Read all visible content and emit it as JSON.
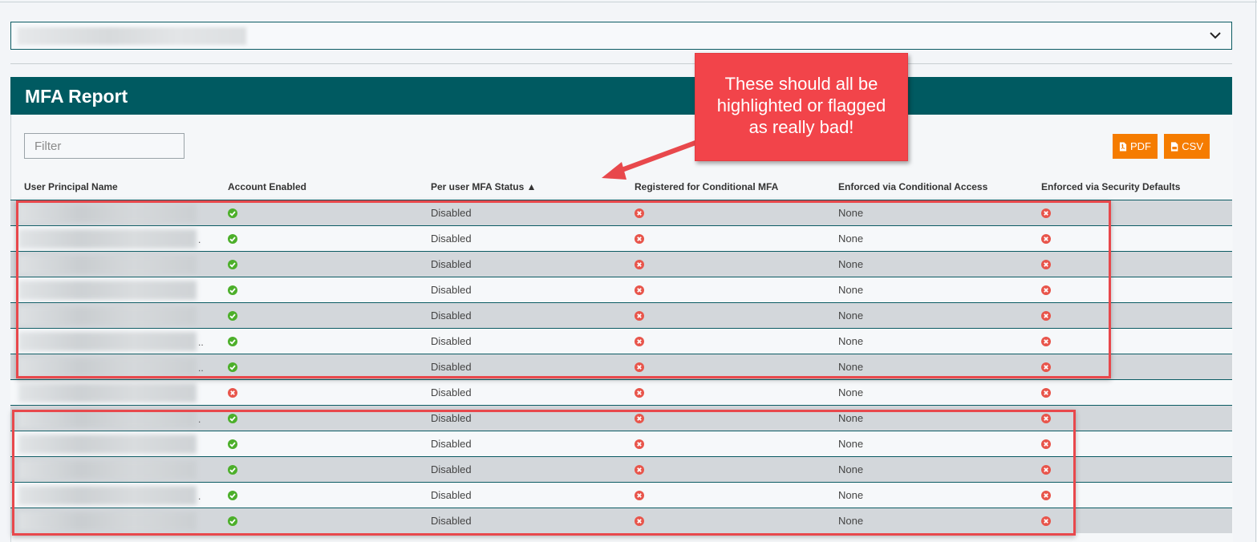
{
  "report": {
    "title": "MFA Report",
    "filter_placeholder": "Filter",
    "pdf_label": "PDF",
    "csv_label": "CSV"
  },
  "table": {
    "columns": [
      "User Principal Name",
      "Account Enabled",
      "Per user MFA Status ▲",
      "Registered for Conditional MFA",
      "Enforced via Conditional Access",
      "Enforced via Security Defaults"
    ],
    "rows": [
      {
        "ellipsis": "",
        "enabled": true,
        "mfa": "Disabled",
        "registered": false,
        "ca": "None",
        "sd": false
      },
      {
        "ellipsis": ".",
        "enabled": true,
        "mfa": "Disabled",
        "registered": false,
        "ca": "None",
        "sd": false
      },
      {
        "ellipsis": "",
        "enabled": true,
        "mfa": "Disabled",
        "registered": false,
        "ca": "None",
        "sd": false
      },
      {
        "ellipsis": "",
        "enabled": true,
        "mfa": "Disabled",
        "registered": false,
        "ca": "None",
        "sd": false
      },
      {
        "ellipsis": "",
        "enabled": true,
        "mfa": "Disabled",
        "registered": false,
        "ca": "None",
        "sd": false
      },
      {
        "ellipsis": "..",
        "enabled": true,
        "mfa": "Disabled",
        "registered": false,
        "ca": "None",
        "sd": false
      },
      {
        "ellipsis": "..",
        "enabled": true,
        "mfa": "Disabled",
        "registered": false,
        "ca": "None",
        "sd": false
      },
      {
        "ellipsis": "",
        "enabled": false,
        "mfa": "Disabled",
        "registered": false,
        "ca": "None",
        "sd": false
      },
      {
        "ellipsis": ".",
        "enabled": true,
        "mfa": "Disabled",
        "registered": false,
        "ca": "None",
        "sd": false
      },
      {
        "ellipsis": "",
        "enabled": true,
        "mfa": "Disabled",
        "registered": false,
        "ca": "None",
        "sd": false
      },
      {
        "ellipsis": "",
        "enabled": true,
        "mfa": "Disabled",
        "registered": false,
        "ca": "None",
        "sd": false
      },
      {
        "ellipsis": ".",
        "enabled": true,
        "mfa": "Disabled",
        "registered": false,
        "ca": "None",
        "sd": false
      },
      {
        "ellipsis": "",
        "enabled": true,
        "mfa": "Disabled",
        "registered": false,
        "ca": "None",
        "sd": false
      }
    ]
  },
  "annotation": {
    "lines": [
      "These should all be",
      "highlighted or flagged",
      "as really bad!"
    ]
  },
  "colors": {
    "header_bg": "#005a61",
    "accent_orange": "#f57c00",
    "check_green": "#4caf2a",
    "x_red": "#e8554b",
    "callout_red": "#f2444a",
    "highlight_red": "#e8484c"
  },
  "icons": {
    "chevron": "chevron-down-icon",
    "pdf": "pdf-file-icon",
    "csv": "csv-file-icon",
    "enabled": "check-circle-icon",
    "not_enabled": "x-circle-icon"
  }
}
